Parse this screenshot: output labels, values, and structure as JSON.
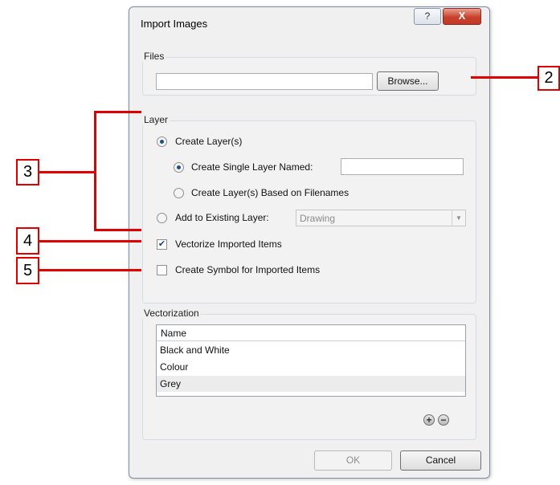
{
  "dialog": {
    "title": "Import Images",
    "help_glyph": "?",
    "close_glyph": "X"
  },
  "files": {
    "group_label": "Files",
    "path_value": "",
    "browse_label": "Browse..."
  },
  "layer": {
    "group_label": "Layer",
    "create_layers": {
      "label": "Create Layer(s)",
      "selected": true
    },
    "single_layer_named": {
      "label": "Create Single Layer Named:",
      "selected": true,
      "value": ""
    },
    "based_on_filenames": {
      "label": "Create Layer(s) Based on Filenames",
      "selected": false
    },
    "add_to_existing": {
      "label": "Add to Existing Layer:",
      "selected": false,
      "dropdown_value": "Drawing"
    },
    "vectorize": {
      "label": "Vectorize Imported Items",
      "checked": true
    },
    "create_symbol": {
      "label": "Create Symbol for Imported Items",
      "checked": false
    }
  },
  "vectorization": {
    "group_label": "Vectorization",
    "column_header": "Name",
    "items": [
      "Black and White",
      "Colour",
      "Grey"
    ],
    "selected_item": "Grey",
    "add_glyph": "+",
    "remove_glyph": "−"
  },
  "footer": {
    "ok_label": "OK",
    "cancel_label": "Cancel"
  },
  "callouts": [
    "2",
    "3",
    "4",
    "5"
  ],
  "colors": {
    "callout_red": "#e00000",
    "close_button": "#c7412c"
  }
}
